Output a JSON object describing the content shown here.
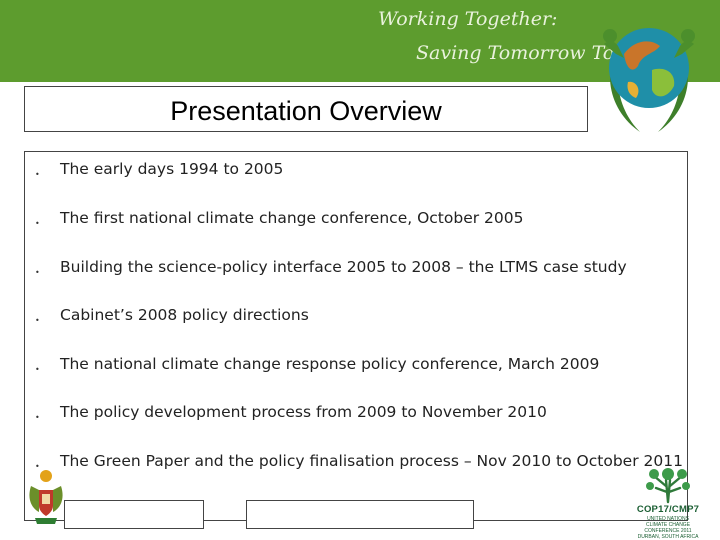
{
  "header": {
    "slogan_line1": "Working Together:",
    "slogan_line2": "Saving Tomorrow Today",
    "banner_color": "#5d9c2e"
  },
  "slide": {
    "title": "Presentation Overview",
    "bullets": [
      "The early days 1994 to 2005",
      "The first national climate change conference, October 2005",
      "Building the science-policy interface 2005 to 2008 – the LTMS case study",
      "Cabinet’s 2008 policy directions",
      "The national climate change response policy conference, March 2009",
      "The policy development process from 2009 to November 2010",
      "The Green Paper and the policy finalisation process – Nov 2010 to October 2011"
    ]
  },
  "footer": {
    "cop_label": "COP17/CMP7",
    "cop_subtext": "UNITED NATIONS CLIMATE CHANGE CONFERENCE 2011 DURBAN, SOUTH AFRICA"
  },
  "icons": [
    "globe-people-logo",
    "coat-of-arms-icon",
    "cop17-tree-logo"
  ]
}
